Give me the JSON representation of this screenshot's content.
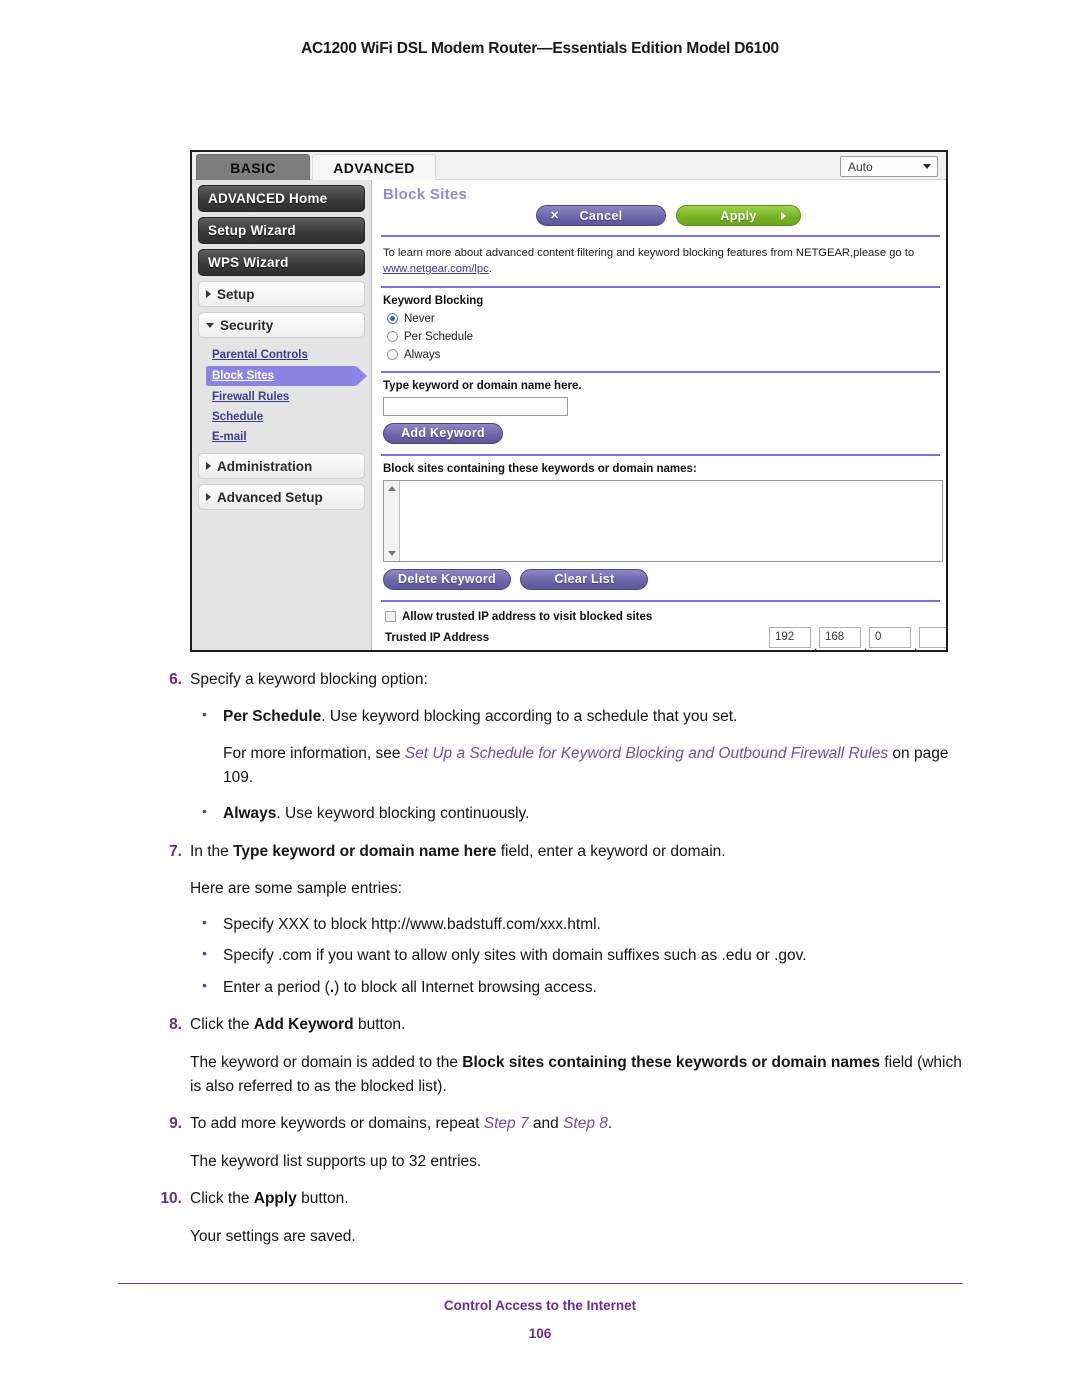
{
  "page_header": "AC1200 WiFi DSL Modem Router—Essentials Edition Model D6100",
  "router_ui": {
    "tabs": [
      {
        "label": "BASIC",
        "active": false
      },
      {
        "label": "ADVANCED",
        "active": true
      }
    ],
    "language_select": {
      "value": "Auto"
    },
    "nav": {
      "buttons": [
        "ADVANCED Home",
        "Setup Wizard",
        "WPS Wizard"
      ],
      "groups": [
        {
          "label": "Setup",
          "expanded": false
        },
        {
          "label": "Security",
          "expanded": true
        },
        {
          "label": "Administration",
          "expanded": false
        },
        {
          "label": "Advanced Setup",
          "expanded": false
        }
      ],
      "security_links": [
        {
          "label": "Parental Controls",
          "active": false
        },
        {
          "label": "Block Sites",
          "active": true
        },
        {
          "label": "Firewall Rules",
          "active": false
        },
        {
          "label": "Schedule",
          "active": false
        },
        {
          "label": "E-mail",
          "active": false
        }
      ]
    },
    "panel": {
      "title": "Block Sites",
      "cancel_label": "Cancel",
      "apply_label": "Apply",
      "info_text": "To learn more about advanced content filtering and keyword blocking features from NETGEAR,please go to ",
      "info_link": "www.netgear.com/lpc",
      "info_tail": ".",
      "keyword_blocking_label": "Keyword Blocking",
      "radios": [
        {
          "label": "Never",
          "selected": true
        },
        {
          "label": "Per Schedule",
          "selected": false
        },
        {
          "label": "Always",
          "selected": false
        }
      ],
      "keyword_field_label": "Type keyword or domain name here.",
      "keyword_field_value": "",
      "add_keyword_label": "Add Keyword",
      "list_label": "Block sites containing these keywords or domain names:",
      "list_items": [],
      "delete_keyword_label": "Delete Keyword",
      "clear_list_label": "Clear List",
      "trusted_checkbox_label": "Allow trusted IP address to visit blocked sites",
      "trusted_checked": false,
      "trusted_ip_label": "Trusted IP Address",
      "trusted_ip_octets": [
        "192",
        "168",
        "0",
        ""
      ]
    },
    "colors": {
      "accent_purple": "#7b6fe0",
      "title_purple": "#8f8ad8",
      "apply_green": "#76b024",
      "cancel_purple": "#6b64a8",
      "active_link": "#8b84e0"
    }
  },
  "steps": {
    "s6_num": "6.",
    "s6_text": "Specify a keyword blocking option:",
    "s6_b1_bold": "Per Schedule",
    "s6_b1_rest": ". Use keyword blocking according to a schedule that you set.",
    "s6_note_lead": "For more information, see ",
    "s6_note_xref": "Set Up a Schedule for Keyword Blocking and Outbound Firewall Rules",
    "s6_note_tail": " on page 109.",
    "s6_b2_bold": "Always",
    "s6_b2_rest": ". Use keyword blocking continuously.",
    "s7_num": "7.",
    "s7_lead": "In the ",
    "s7_bold": "Type keyword or domain name here",
    "s7_tail": " field, enter a keyword or domain.",
    "s7_sub": "Here are some sample entries:",
    "s7_b1": "Specify XXX to block http://www.badstuff.com/xxx.html.",
    "s7_b2": "Specify .com if you want to allow only sites with domain suffixes such as .edu or .gov.",
    "s7_b3_lead": "Enter a period (",
    "s7_b3_bold": ".",
    "s7_b3_tail": ") to block all Internet browsing access.",
    "s8_num": "8.",
    "s8_lead": "Click the ",
    "s8_bold": "Add Keyword",
    "s8_tail": " button.",
    "s8_p_lead": "The keyword or domain is added to the ",
    "s8_p_bold": "Block sites containing these keywords or domain names",
    "s8_p_tail": " field (which is also referred to as the blocked list).",
    "s9_num": "9.",
    "s9_lead": "To add more keywords or domains, repeat ",
    "s9_x1": "Step 7",
    "s9_mid": " and ",
    "s9_x2": "Step 8",
    "s9_tail": ".",
    "s9_p": "The keyword list supports up to 32 entries.",
    "s10_num": "10.",
    "s10_lead": "Click the ",
    "s10_bold": "Apply",
    "s10_tail": " button.",
    "s10_p": "Your settings are saved."
  },
  "footer": {
    "title": "Control Access to the Internet",
    "page_number": "106"
  }
}
